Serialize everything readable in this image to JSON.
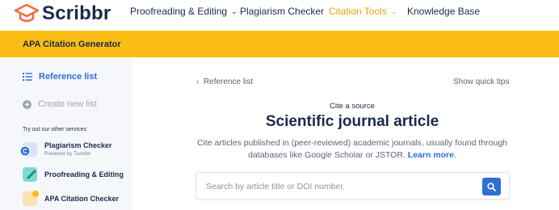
{
  "brand": {
    "name": "Scribbr"
  },
  "nav": {
    "items": [
      {
        "label": "Proofreading & Editing",
        "has_dropdown": true
      },
      {
        "label": "Plagiarism Checker",
        "has_dropdown": false
      },
      {
        "label": "Citation Tools",
        "has_dropdown": true
      },
      {
        "label": "Knowledge Base",
        "has_dropdown": false
      }
    ]
  },
  "band": {
    "title": "APA Citation Generator"
  },
  "sidebar": {
    "reference_list": "Reference list",
    "create_new_list": "Create new list",
    "other_services_heading": "Try out our other services",
    "services": [
      {
        "title": "Plagiarism Checker",
        "subtitle": "Powered by Turnitin"
      },
      {
        "title": "Proofreading & Editing"
      },
      {
        "title": "APA Citation Checker"
      }
    ]
  },
  "main": {
    "back_link": "Reference list",
    "quick_tips": "Show quick tips",
    "kicker": "Cite a source",
    "heading": "Scientific journal article",
    "description": "Cite articles published in (peer-reviewed) academic journals, usually found through databases like Google Scholar or JSTOR.",
    "learn_more": "Learn more",
    "search_placeholder": "Search by article title or DOI number."
  },
  "colors": {
    "accent_yellow": "#fbbc13",
    "brand_orange": "#f26d3d",
    "link_blue": "#2d6fd6",
    "navy": "#1b2a4a",
    "active_nav": "#e9a411"
  }
}
